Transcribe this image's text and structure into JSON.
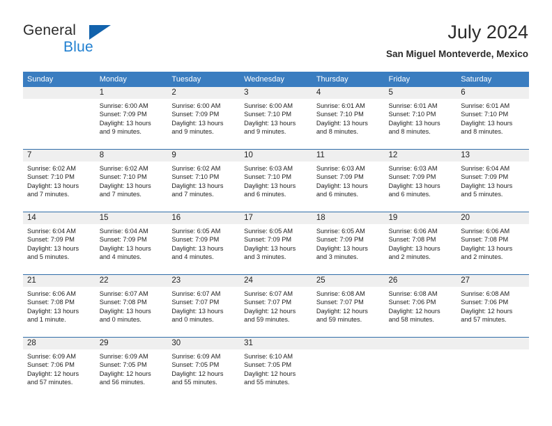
{
  "brand": {
    "name_top": "General",
    "name_bottom": "Blue",
    "triangle_color": "#1262ac",
    "blue_color": "#1f7fd0"
  },
  "header": {
    "title": "July 2024",
    "subtitle": "San Miguel Monteverde, Mexico"
  },
  "theme": {
    "header_blue": "#3a7dc0",
    "row_divider_blue": "#2f6ca8",
    "day_band_gray": "#efefef",
    "text_color": "#222222"
  },
  "weekdays": [
    "Sunday",
    "Monday",
    "Tuesday",
    "Wednesday",
    "Thursday",
    "Friday",
    "Saturday"
  ],
  "weeks": [
    [
      {
        "day": "",
        "sunrise": "",
        "sunset": "",
        "daylight_line1": "",
        "daylight_line2": "",
        "empty": true
      },
      {
        "day": "1",
        "sunrise": "Sunrise: 6:00 AM",
        "sunset": "Sunset: 7:09 PM",
        "daylight_line1": "Daylight: 13 hours",
        "daylight_line2": "and 9 minutes."
      },
      {
        "day": "2",
        "sunrise": "Sunrise: 6:00 AM",
        "sunset": "Sunset: 7:09 PM",
        "daylight_line1": "Daylight: 13 hours",
        "daylight_line2": "and 9 minutes."
      },
      {
        "day": "3",
        "sunrise": "Sunrise: 6:00 AM",
        "sunset": "Sunset: 7:10 PM",
        "daylight_line1": "Daylight: 13 hours",
        "daylight_line2": "and 9 minutes."
      },
      {
        "day": "4",
        "sunrise": "Sunrise: 6:01 AM",
        "sunset": "Sunset: 7:10 PM",
        "daylight_line1": "Daylight: 13 hours",
        "daylight_line2": "and 8 minutes."
      },
      {
        "day": "5",
        "sunrise": "Sunrise: 6:01 AM",
        "sunset": "Sunset: 7:10 PM",
        "daylight_line1": "Daylight: 13 hours",
        "daylight_line2": "and 8 minutes."
      },
      {
        "day": "6",
        "sunrise": "Sunrise: 6:01 AM",
        "sunset": "Sunset: 7:10 PM",
        "daylight_line1": "Daylight: 13 hours",
        "daylight_line2": "and 8 minutes."
      }
    ],
    [
      {
        "day": "7",
        "sunrise": "Sunrise: 6:02 AM",
        "sunset": "Sunset: 7:10 PM",
        "daylight_line1": "Daylight: 13 hours",
        "daylight_line2": "and 7 minutes."
      },
      {
        "day": "8",
        "sunrise": "Sunrise: 6:02 AM",
        "sunset": "Sunset: 7:10 PM",
        "daylight_line1": "Daylight: 13 hours",
        "daylight_line2": "and 7 minutes."
      },
      {
        "day": "9",
        "sunrise": "Sunrise: 6:02 AM",
        "sunset": "Sunset: 7:10 PM",
        "daylight_line1": "Daylight: 13 hours",
        "daylight_line2": "and 7 minutes."
      },
      {
        "day": "10",
        "sunrise": "Sunrise: 6:03 AM",
        "sunset": "Sunset: 7:10 PM",
        "daylight_line1": "Daylight: 13 hours",
        "daylight_line2": "and 6 minutes."
      },
      {
        "day": "11",
        "sunrise": "Sunrise: 6:03 AM",
        "sunset": "Sunset: 7:09 PM",
        "daylight_line1": "Daylight: 13 hours",
        "daylight_line2": "and 6 minutes."
      },
      {
        "day": "12",
        "sunrise": "Sunrise: 6:03 AM",
        "sunset": "Sunset: 7:09 PM",
        "daylight_line1": "Daylight: 13 hours",
        "daylight_line2": "and 6 minutes."
      },
      {
        "day": "13",
        "sunrise": "Sunrise: 6:04 AM",
        "sunset": "Sunset: 7:09 PM",
        "daylight_line1": "Daylight: 13 hours",
        "daylight_line2": "and 5 minutes."
      }
    ],
    [
      {
        "day": "14",
        "sunrise": "Sunrise: 6:04 AM",
        "sunset": "Sunset: 7:09 PM",
        "daylight_line1": "Daylight: 13 hours",
        "daylight_line2": "and 5 minutes."
      },
      {
        "day": "15",
        "sunrise": "Sunrise: 6:04 AM",
        "sunset": "Sunset: 7:09 PM",
        "daylight_line1": "Daylight: 13 hours",
        "daylight_line2": "and 4 minutes."
      },
      {
        "day": "16",
        "sunrise": "Sunrise: 6:05 AM",
        "sunset": "Sunset: 7:09 PM",
        "daylight_line1": "Daylight: 13 hours",
        "daylight_line2": "and 4 minutes."
      },
      {
        "day": "17",
        "sunrise": "Sunrise: 6:05 AM",
        "sunset": "Sunset: 7:09 PM",
        "daylight_line1": "Daylight: 13 hours",
        "daylight_line2": "and 3 minutes."
      },
      {
        "day": "18",
        "sunrise": "Sunrise: 6:05 AM",
        "sunset": "Sunset: 7:09 PM",
        "daylight_line1": "Daylight: 13 hours",
        "daylight_line2": "and 3 minutes."
      },
      {
        "day": "19",
        "sunrise": "Sunrise: 6:06 AM",
        "sunset": "Sunset: 7:08 PM",
        "daylight_line1": "Daylight: 13 hours",
        "daylight_line2": "and 2 minutes."
      },
      {
        "day": "20",
        "sunrise": "Sunrise: 6:06 AM",
        "sunset": "Sunset: 7:08 PM",
        "daylight_line1": "Daylight: 13 hours",
        "daylight_line2": "and 2 minutes."
      }
    ],
    [
      {
        "day": "21",
        "sunrise": "Sunrise: 6:06 AM",
        "sunset": "Sunset: 7:08 PM",
        "daylight_line1": "Daylight: 13 hours",
        "daylight_line2": "and 1 minute."
      },
      {
        "day": "22",
        "sunrise": "Sunrise: 6:07 AM",
        "sunset": "Sunset: 7:08 PM",
        "daylight_line1": "Daylight: 13 hours",
        "daylight_line2": "and 0 minutes."
      },
      {
        "day": "23",
        "sunrise": "Sunrise: 6:07 AM",
        "sunset": "Sunset: 7:07 PM",
        "daylight_line1": "Daylight: 13 hours",
        "daylight_line2": "and 0 minutes."
      },
      {
        "day": "24",
        "sunrise": "Sunrise: 6:07 AM",
        "sunset": "Sunset: 7:07 PM",
        "daylight_line1": "Daylight: 12 hours",
        "daylight_line2": "and 59 minutes."
      },
      {
        "day": "25",
        "sunrise": "Sunrise: 6:08 AM",
        "sunset": "Sunset: 7:07 PM",
        "daylight_line1": "Daylight: 12 hours",
        "daylight_line2": "and 59 minutes."
      },
      {
        "day": "26",
        "sunrise": "Sunrise: 6:08 AM",
        "sunset": "Sunset: 7:06 PM",
        "daylight_line1": "Daylight: 12 hours",
        "daylight_line2": "and 58 minutes."
      },
      {
        "day": "27",
        "sunrise": "Sunrise: 6:08 AM",
        "sunset": "Sunset: 7:06 PM",
        "daylight_line1": "Daylight: 12 hours",
        "daylight_line2": "and 57 minutes."
      }
    ],
    [
      {
        "day": "28",
        "sunrise": "Sunrise: 6:09 AM",
        "sunset": "Sunset: 7:06 PM",
        "daylight_line1": "Daylight: 12 hours",
        "daylight_line2": "and 57 minutes."
      },
      {
        "day": "29",
        "sunrise": "Sunrise: 6:09 AM",
        "sunset": "Sunset: 7:05 PM",
        "daylight_line1": "Daylight: 12 hours",
        "daylight_line2": "and 56 minutes."
      },
      {
        "day": "30",
        "sunrise": "Sunrise: 6:09 AM",
        "sunset": "Sunset: 7:05 PM",
        "daylight_line1": "Daylight: 12 hours",
        "daylight_line2": "and 55 minutes."
      },
      {
        "day": "31",
        "sunrise": "Sunrise: 6:10 AM",
        "sunset": "Sunset: 7:05 PM",
        "daylight_line1": "Daylight: 12 hours",
        "daylight_line2": "and 55 minutes."
      },
      {
        "day": "",
        "sunrise": "",
        "sunset": "",
        "daylight_line1": "",
        "daylight_line2": "",
        "empty": true
      },
      {
        "day": "",
        "sunrise": "",
        "sunset": "",
        "daylight_line1": "",
        "daylight_line2": "",
        "empty": true
      },
      {
        "day": "",
        "sunrise": "",
        "sunset": "",
        "daylight_line1": "",
        "daylight_line2": "",
        "empty": true
      }
    ]
  ]
}
